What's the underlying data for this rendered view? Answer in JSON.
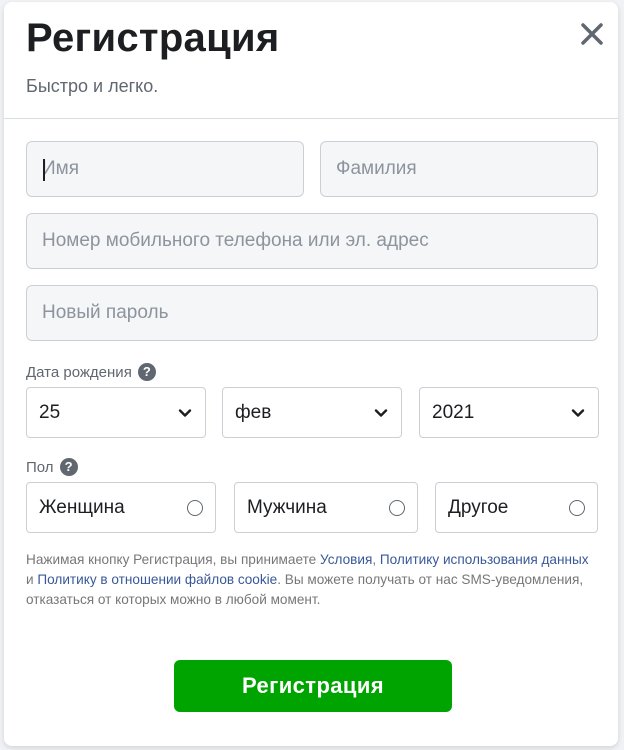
{
  "header": {
    "title": "Регистрация",
    "subtitle": "Быстро и легко."
  },
  "icons": {
    "close": "close-icon",
    "help": "question-circle-icon",
    "dropdown": "chevron-down-icon"
  },
  "form": {
    "first_name": {
      "value": "",
      "placeholder": "Имя"
    },
    "last_name": {
      "value": "",
      "placeholder": "Фамилия"
    },
    "contact": {
      "value": "",
      "placeholder": "Номер мобильного телефона или эл. адрес"
    },
    "password": {
      "value": "",
      "placeholder": "Новый пароль"
    },
    "birth_label": "Дата рождения",
    "birth": {
      "day": "25",
      "month": "фев",
      "year": "2021"
    },
    "gender_label": "Пол",
    "genders": [
      "Женщина",
      "Мужчина",
      "Другое"
    ],
    "help_glyph": "?"
  },
  "terms": {
    "part1": "Нажимая кнопку Регистрация, вы принимаете ",
    "link_terms": "Условия",
    "part2": ", ",
    "link_data": "Политику использования данных",
    "part3": " и ",
    "link_cookie": "Политику в отношении файлов cookie",
    "part4": ". Вы можете получать от нас SMS-уведомления, отказаться от которых можно в любой момент."
  },
  "submit_label": "Регистрация",
  "colors": {
    "accent_green": "#00a400",
    "link": "#385898",
    "text": "#1c1e21",
    "muted": "#606770"
  }
}
